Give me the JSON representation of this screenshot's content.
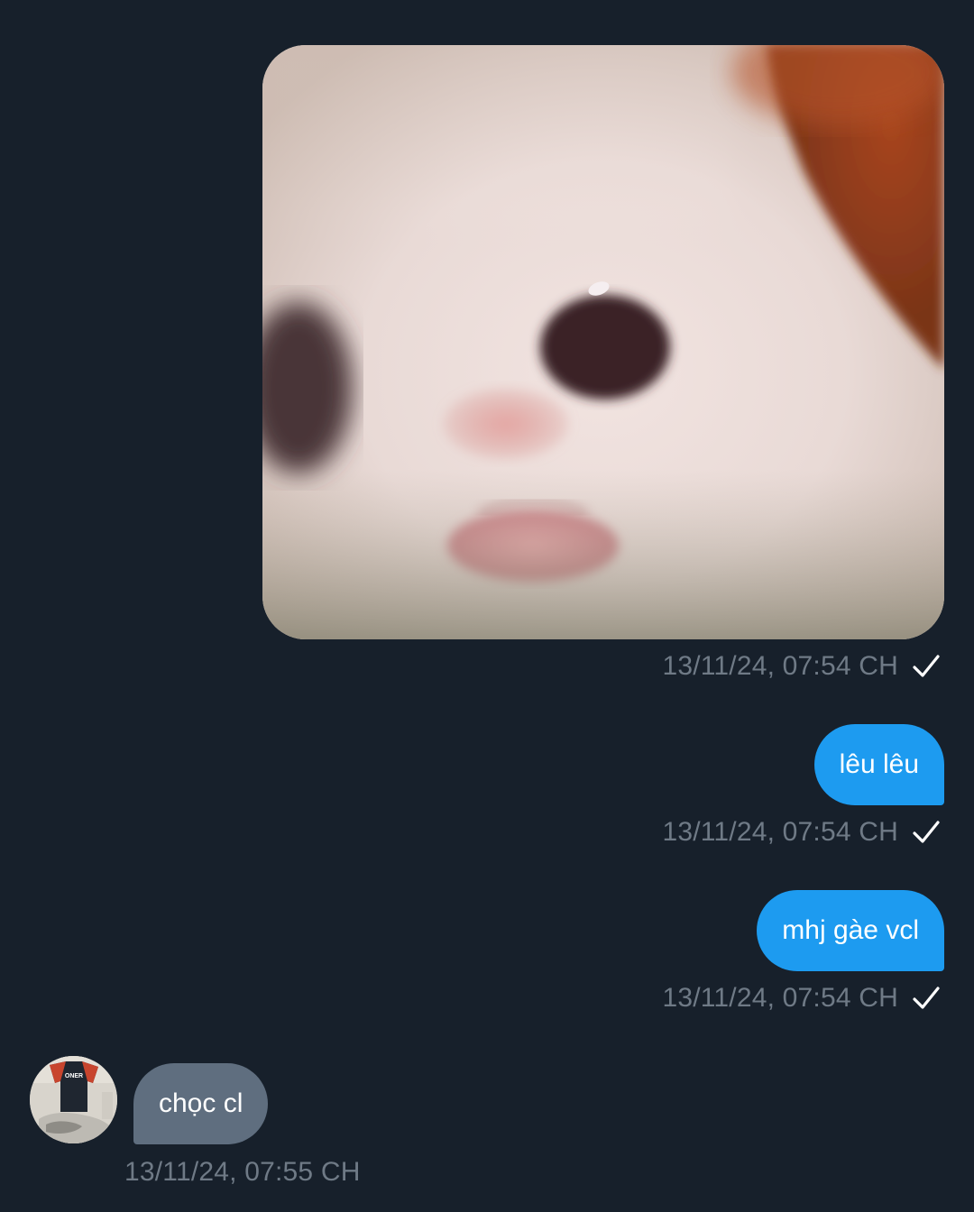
{
  "messages": [
    {
      "direction": "outgoing",
      "type": "image",
      "image_subject": "close-up photo of a white kitten sticking its tongue out",
      "timestamp": "13/11/24, 07:54 CH",
      "status_icon": "check-icon"
    },
    {
      "direction": "outgoing",
      "type": "text",
      "text": "lêu lêu",
      "timestamp": "13/11/24, 07:54 CH",
      "status_icon": "check-icon"
    },
    {
      "direction": "outgoing",
      "type": "text",
      "text": "mhj gàe vcl",
      "timestamp": "13/11/24, 07:54 CH",
      "status_icon": "check-icon"
    },
    {
      "direction": "incoming",
      "type": "text",
      "text": "chọc cl",
      "timestamp": "13/11/24, 07:55 CH",
      "avatar_icon": "avatar"
    }
  ],
  "avatar_shirt_text": "ONER",
  "colors": {
    "background": "#17202b",
    "outgoing_bubble": "#1d9bf0",
    "incoming_bubble": "#5f6e7f",
    "timestamp": "#6f7a86"
  }
}
